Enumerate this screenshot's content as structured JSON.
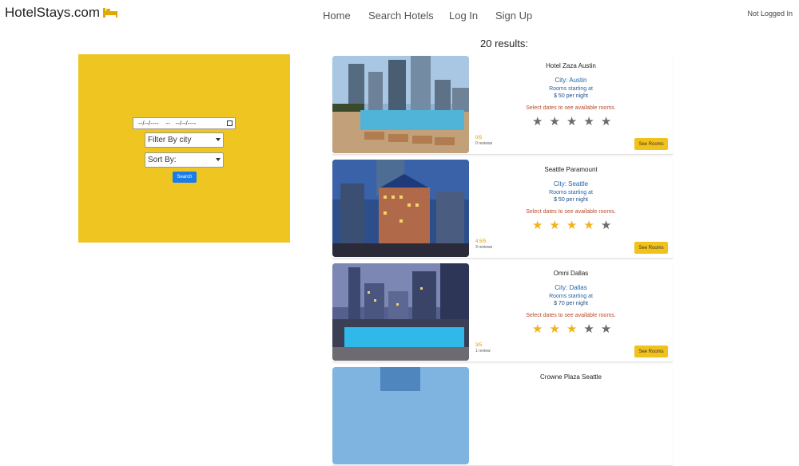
{
  "brand": {
    "name": "HotelStays.com",
    "icon": "bed-icon"
  },
  "nav": {
    "home": "Home",
    "search": "Search Hotels",
    "login": "Log In",
    "signup": "Sign Up"
  },
  "status": "Not Logged In",
  "filters": {
    "date_text": "--/--/----    --   --/--/----",
    "city_select": "Filter By city",
    "sort_select": "Sort By:",
    "search_button": "Search"
  },
  "results_title": "20 results:",
  "hotels": [
    {
      "name": "Hotel Zaza Austin",
      "city": "City: Austin",
      "rooms_label": "Rooms starting at",
      "price": "$ 50 per night",
      "note": "Select dates to see available rooms.",
      "stars": 0,
      "rating": "0/5",
      "reviews": "0 reviews",
      "button": "See Rooms"
    },
    {
      "name": "Seattle Paramount",
      "city": "City: Seattle",
      "rooms_label": "Rooms starting at",
      "price": "$ 50 per night",
      "note": "Select dates to see available rooms.",
      "stars": 4,
      "rating": "4.5/5",
      "reviews": "3 reviews",
      "button": "See Rooms"
    },
    {
      "name": "Omni Dallas",
      "city": "City: Dallas",
      "rooms_label": "Rooms starting at",
      "price": "$ 70 per night",
      "note": "Select dates to see available rooms.",
      "stars": 3,
      "rating": "3/5",
      "reviews": "1 review",
      "button": "See Rooms"
    },
    {
      "name": "Crowne Plaza Seattle"
    }
  ],
  "colors": {
    "panel": "#eec521",
    "accent": "#1a7ce8",
    "star": "#f2b21a",
    "button": "#f2c21c"
  }
}
